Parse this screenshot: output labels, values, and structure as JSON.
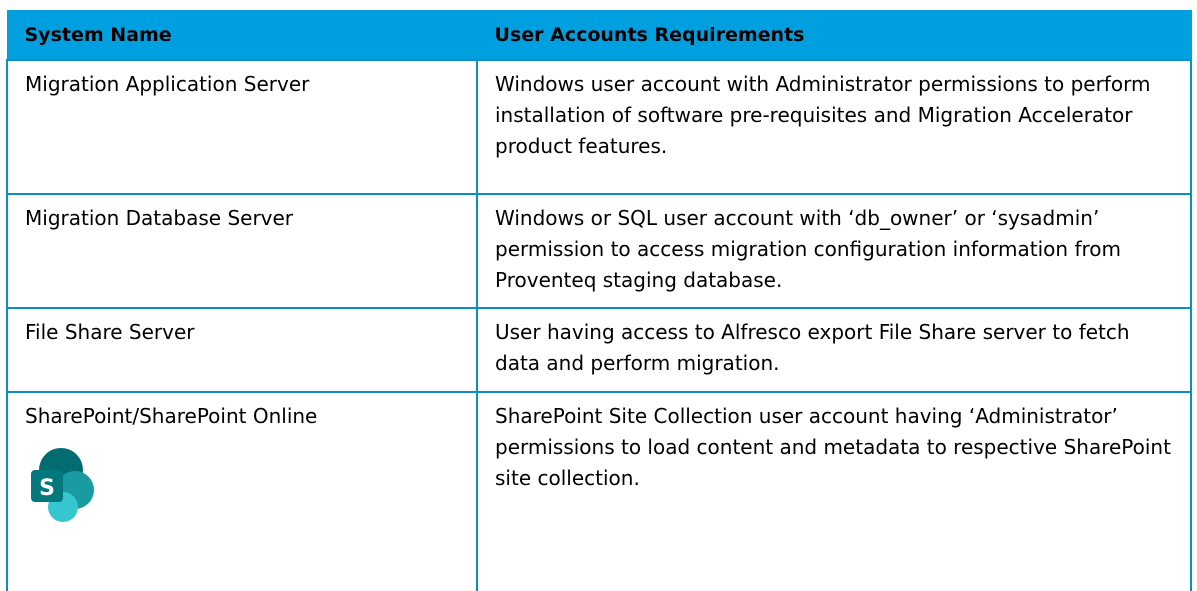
{
  "table": {
    "headers": [
      "System Name",
      "User Accounts Requirements"
    ],
    "rows": [
      {
        "system": "Migration Application Server",
        "requirement": "Windows user account with Administrator permissions to perform installation of software pre-requisites and Migration Accelerator product features."
      },
      {
        "system": "Migration Database Server",
        "requirement": "Windows or SQL user account with ‘db_owner’ or ‘sysadmin’ permission to access migration configuration information from Proventeq staging database."
      },
      {
        "system": "File Share Server",
        "requirement": "User having access to Alfresco export File Share server to fetch data and perform migration."
      },
      {
        "system": "SharePoint/SharePoint Online",
        "requirement": "SharePoint Site Collection user account having ‘Administrator’ permissions to load content and metadata to respective SharePoint site collection.",
        "icon": "sharepoint-logo-icon",
        "icon_letter": "S"
      }
    ]
  },
  "colors": {
    "header_bg": "#00a0e0",
    "border": "#0a8fc5",
    "sharepoint_dark": "#036c70",
    "sharepoint_mid": "#1a9ba1",
    "sharepoint_light": "#37c6d0"
  }
}
